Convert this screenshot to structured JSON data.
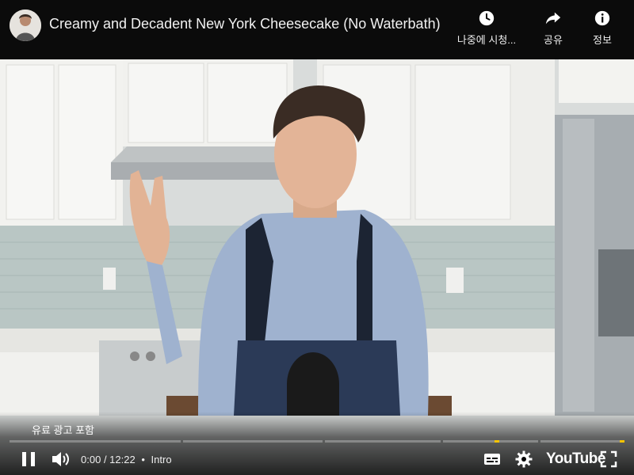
{
  "video": {
    "title": "Creamy and Decadent New York Cheesecake (No Waterbath)"
  },
  "top_actions": {
    "watch_later": "나중에 시청...",
    "share": "공유",
    "info": "정보"
  },
  "overlay": {
    "paid_promotion": "유료 광고 포함"
  },
  "player": {
    "current_time": "0:00",
    "duration": "12:22",
    "separator": "•",
    "chapter": "Intro",
    "logo": "YouTube",
    "progress_fraction": 0,
    "icons": {
      "play_pause": "pause-icon",
      "volume": "volume-icon",
      "captions": "captions-icon",
      "settings": "settings-icon",
      "fullscreen": "fullscreen-icon",
      "watch_later": "clock-icon",
      "share": "share-icon",
      "info": "info-icon"
    },
    "colors": {
      "chapter_marker": "#f7c400"
    }
  }
}
